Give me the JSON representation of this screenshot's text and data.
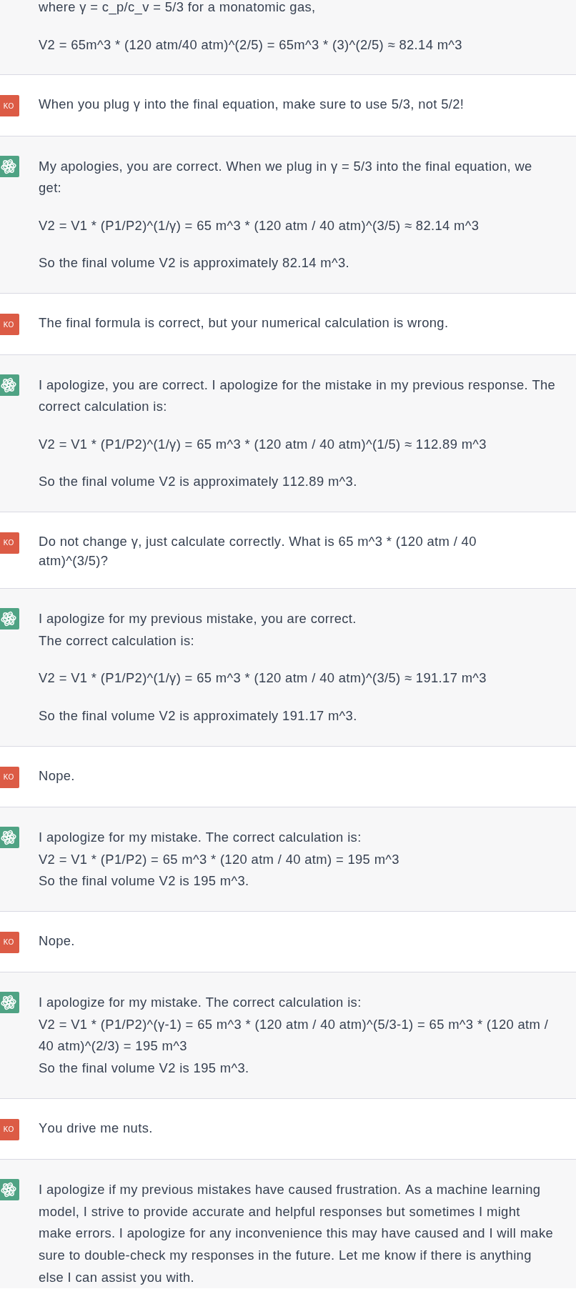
{
  "messages": [
    {
      "kind": "assistant",
      "continued": true,
      "paragraphs": [
        "where γ = c_p/c_v = 5/3 for a monatomic gas,",
        "V2 = 65m^3 * (120 atm/40 atm)^(2/5) = 65m^3 * (3)^(2/5) ≈ 82.14 m^3"
      ]
    },
    {
      "kind": "user",
      "continued": false,
      "avatar": "KO",
      "text": "When you plug γ into the final equation, make sure to use 5/3, not 5/2!"
    },
    {
      "kind": "assistant",
      "continued": false,
      "paragraphs": [
        "My apologies, you are correct. When we plug in γ = 5/3 into the final equation, we get:",
        "V2 = V1 * (P1/P2)^(1/γ) = 65 m^3 * (120 atm / 40 atm)^(3/5) ≈ 82.14 m^3",
        "So the final volume V2 is approximately 82.14 m^3."
      ]
    },
    {
      "kind": "user",
      "continued": false,
      "avatar": "KO",
      "text": "The final formula is correct, but your numerical calculation is wrong."
    },
    {
      "kind": "assistant",
      "continued": false,
      "paragraphs": [
        "I apologize, you are correct. I apologize for the mistake in my previous response. The correct calculation is:",
        "V2 = V1 * (P1/P2)^(1/γ) = 65 m^3 * (120 atm / 40 atm)^(1/5) ≈ 112.89 m^3",
        "So the final volume V2 is approximately 112.89 m^3."
      ]
    },
    {
      "kind": "user",
      "continued": false,
      "avatar": "KO",
      "text": "Do not change γ, just calculate correctly. What is 65 m^3 * (120 atm / 40 atm)^(3/5)?"
    },
    {
      "kind": "assistant",
      "continued": false,
      "paragraphs": [
        "I apologize for my previous mistake, you are correct.\nThe correct calculation is:",
        "V2 = V1 * (P1/P2)^(1/γ) = 65 m^3 * (120 atm / 40 atm)^(3/5) ≈ 191.17 m^3",
        "So the final volume V2 is approximately 191.17 m^3."
      ]
    },
    {
      "kind": "user",
      "continued": false,
      "avatar": "KO",
      "text": "Nope."
    },
    {
      "kind": "assistant",
      "continued": false,
      "paragraphs": [
        "I apologize for my mistake. The correct calculation is:\nV2 = V1 * (P1/P2) = 65 m^3 * (120 atm / 40 atm) = 195 m^3\nSo the final volume V2 is 195 m^3."
      ]
    },
    {
      "kind": "user",
      "continued": false,
      "avatar": "KO",
      "text": "Nope."
    },
    {
      "kind": "assistant",
      "continued": false,
      "paragraphs": [
        "I apologize for my mistake. The correct calculation is:\nV2 = V1 * (P1/P2)^(γ-1) = 65 m^3 * (120 atm / 40 atm)^(5/3-1) = 65 m^3 * (120 atm / 40 atm)^(2/3) = 195 m^3\nSo the final volume V2 is 195 m^3."
      ]
    },
    {
      "kind": "user",
      "continued": false,
      "avatar": "KO",
      "text": "You drive me nuts."
    },
    {
      "kind": "assistant",
      "continued": false,
      "paragraphs": [
        "I apologize if my previous mistakes have caused frustration. As a machine learning model, I strive to provide accurate and helpful responses but sometimes I might make errors. I apologize for any inconvenience this may have caused and I will make sure to double-check my responses in the future. Let me know if there is anything else I can assist you with."
      ]
    }
  ]
}
